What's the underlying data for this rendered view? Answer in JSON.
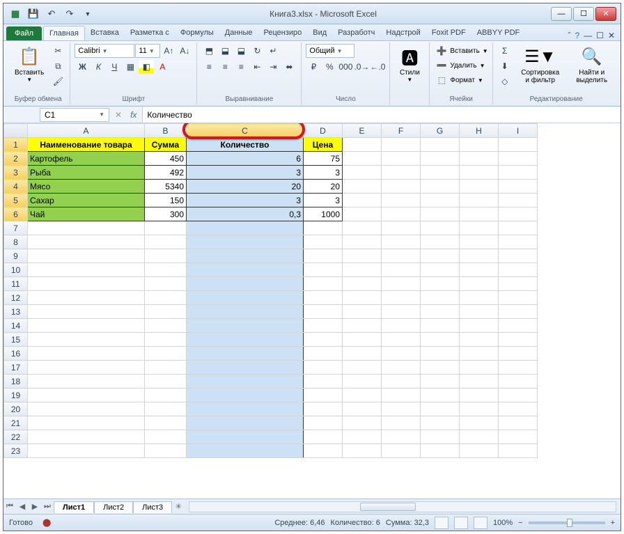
{
  "window": {
    "title": "Книга3.xlsx  -  Microsoft Excel"
  },
  "qat": {
    "save_tip": "save",
    "undo_tip": "undo",
    "redo_tip": "redo"
  },
  "tabs": {
    "file": "Файл",
    "list": [
      "Главная",
      "Вставка",
      "Разметка с",
      "Формулы",
      "Данные",
      "Рецензиро",
      "Вид",
      "Разработч",
      "Надстрой",
      "Foxit PDF",
      "ABBYY PDF"
    ],
    "active_index": 0
  },
  "ribbon": {
    "clipboard": {
      "paste": "Вставить",
      "label": "Буфер обмена"
    },
    "font": {
      "name": "Calibri",
      "size": "11",
      "label": "Шрифт"
    },
    "alignment": {
      "label": "Выравнивание"
    },
    "number": {
      "format": "Общий",
      "label": "Число"
    },
    "styles": {
      "btn": "Стили",
      "label": ""
    },
    "cells": {
      "insert": "Вставить",
      "delete": "Удалить",
      "format": "Формат",
      "label": "Ячейки"
    },
    "editing": {
      "sort": "Сортировка и фильтр",
      "find": "Найти и выделить",
      "label": "Редактирование"
    }
  },
  "formula_bar": {
    "name_box": "C1",
    "formula": "Количество"
  },
  "sheet": {
    "columns": [
      "A",
      "B",
      "C",
      "D",
      "E",
      "F",
      "G",
      "H",
      "I"
    ],
    "headers": {
      "A": "Наименование товара",
      "B": "Сумма",
      "C": "Количество",
      "D": "Цена"
    },
    "rows": [
      {
        "A": "Картофель",
        "B": "450",
        "C": "6",
        "D": "75"
      },
      {
        "A": "Рыба",
        "B": "492",
        "C": "3",
        "D": "3"
      },
      {
        "A": "Мясо",
        "B": "5340",
        "C": "20",
        "D": "20"
      },
      {
        "A": "Сахар",
        "B": "150",
        "C": "3",
        "D": "3"
      },
      {
        "A": "Чай",
        "B": "300",
        "C": "0,3",
        "D": "1000"
      }
    ],
    "total_rows": 23,
    "selected_col": "C"
  },
  "sheet_tabs": {
    "list": [
      "Лист1",
      "Лист2",
      "Лист3"
    ],
    "active": 0
  },
  "status": {
    "ready": "Готово",
    "avg_label": "Среднее:",
    "avg": "6,46",
    "count_label": "Количество:",
    "count": "6",
    "sum_label": "Сумма:",
    "sum": "32,3",
    "zoom": "100%"
  }
}
